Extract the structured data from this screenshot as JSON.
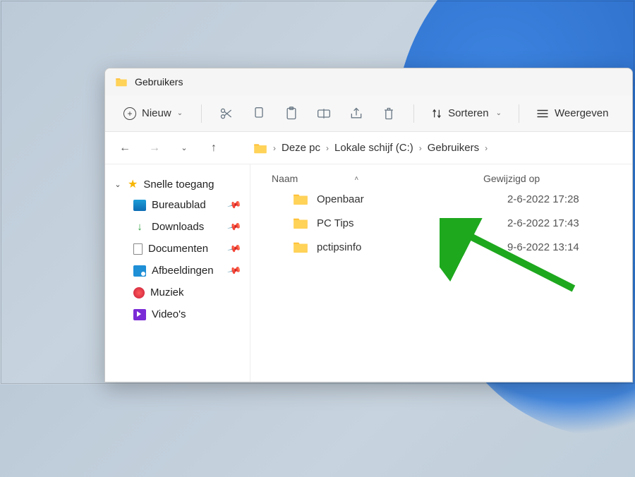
{
  "title": "Gebruikers",
  "toolbar": {
    "new": "Nieuw",
    "sort": "Sorteren",
    "view": "Weergeven"
  },
  "breadcrumb": [
    "Deze pc",
    "Lokale schijf (C:)",
    "Gebruikers"
  ],
  "columns": {
    "name": "Naam",
    "modified": "Gewijzigd op"
  },
  "sidebar": {
    "quick_access": "Snelle toegang",
    "items": [
      {
        "label": "Bureaublad",
        "pinned": true
      },
      {
        "label": "Downloads",
        "pinned": true
      },
      {
        "label": "Documenten",
        "pinned": true
      },
      {
        "label": "Afbeeldingen",
        "pinned": true
      },
      {
        "label": "Muziek",
        "pinned": false
      },
      {
        "label": "Video's",
        "pinned": false
      }
    ]
  },
  "rows": [
    {
      "name": "Openbaar",
      "date": "2-6-2022 17:28"
    },
    {
      "name": "PC Tips",
      "date": "2-6-2022 17:43"
    },
    {
      "name": "pctipsinfo",
      "date": "9-6-2022 13:14"
    }
  ]
}
